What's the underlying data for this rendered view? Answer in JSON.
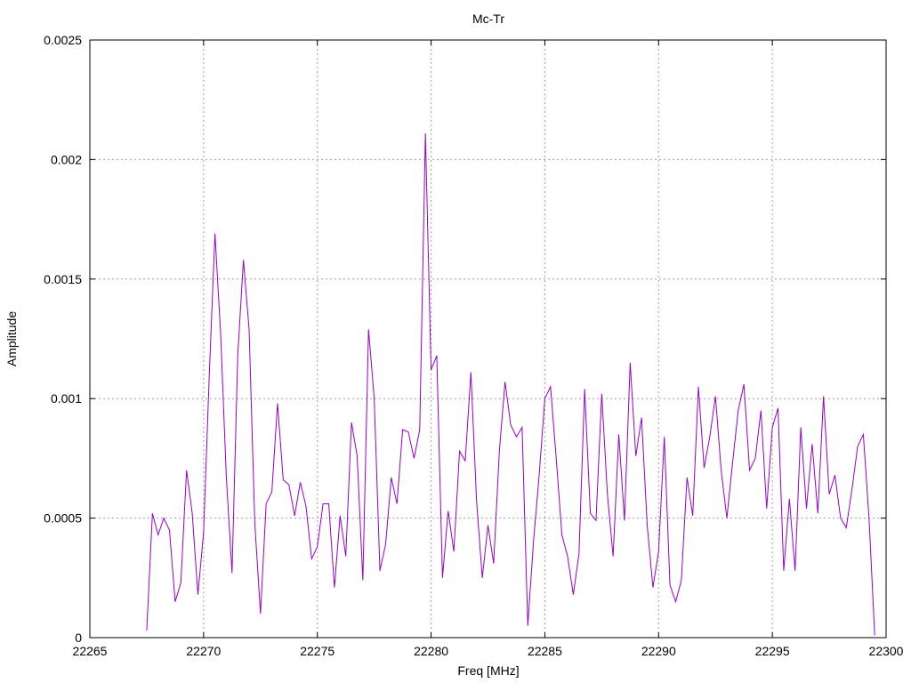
{
  "chart_data": {
    "type": "line",
    "title": "Mc-Tr",
    "xlabel": "Freq [MHz]",
    "ylabel": "Amplitude",
    "xlim": [
      22265,
      22300
    ],
    "ylim": [
      0,
      0.0025
    ],
    "x_ticks": [
      22265,
      22270,
      22275,
      22280,
      22285,
      22290,
      22295,
      22300
    ],
    "x_tick_labels": [
      "22265",
      "22270",
      "22275",
      "22280",
      "22285",
      "22290",
      "22295",
      "22300"
    ],
    "y_ticks": [
      0,
      0.0005,
      0.001,
      0.0015,
      0.002,
      0.0025
    ],
    "y_tick_labels": [
      "0",
      "0.0005",
      "0.001",
      "0.0015",
      "0.002",
      "0.0025"
    ],
    "grid": true,
    "line_color": "#9400d3",
    "series": [
      {
        "x": [
          22267.5,
          22267.75,
          22268.0,
          22268.25,
          22268.5,
          22268.75,
          22269.0,
          22269.25,
          22269.5,
          22269.75,
          22270.0,
          22270.25,
          22270.5,
          22270.75,
          22271.0,
          22271.25,
          22271.5,
          22271.75,
          22272.0,
          22272.25,
          22272.5,
          22272.75,
          22273.0,
          22273.25,
          22273.5,
          22273.75,
          22274.0,
          22274.25,
          22274.5,
          22274.75,
          22275.0,
          22275.25,
          22275.5,
          22275.75,
          22276.0,
          22276.25,
          22276.5,
          22276.75,
          22277.0,
          22277.25,
          22277.5,
          22277.75,
          22278.0,
          22278.25,
          22278.5,
          22278.75,
          22279.0,
          22279.25,
          22279.5,
          22279.75,
          22280.0,
          22280.25,
          22280.5,
          22280.75,
          22281.0,
          22281.25,
          22281.5,
          22281.75,
          22282.0,
          22282.25,
          22282.5,
          22282.75,
          22283.0,
          22283.25,
          22283.5,
          22283.75,
          22284.0,
          22284.25,
          22284.5,
          22284.75,
          22285.0,
          22285.25,
          22285.5,
          22285.75,
          22286.0,
          22286.25,
          22286.5,
          22286.75,
          22287.0,
          22287.25,
          22287.5,
          22287.75,
          22288.0,
          22288.25,
          22288.5,
          22288.75,
          22289.0,
          22289.25,
          22289.5,
          22289.75,
          22290.0,
          22290.25,
          22290.5,
          22290.75,
          22291.0,
          22291.25,
          22291.5,
          22291.75,
          22292.0,
          22292.25,
          22292.5,
          22292.75,
          22293.0,
          22293.25,
          22293.5,
          22293.75,
          22294.0,
          22294.25,
          22294.5,
          22294.75,
          22295.0,
          22295.25,
          22295.5,
          22295.75,
          22296.0,
          22296.25,
          22296.5,
          22296.75,
          22297.0,
          22297.25,
          22297.5,
          22297.75,
          22298.0,
          22298.25,
          22298.5,
          22298.75,
          22299.0,
          22299.25,
          22299.5
        ],
        "y": [
          3e-05,
          0.00052,
          0.00043,
          0.0005,
          0.00045,
          0.00015,
          0.00023,
          0.0007,
          0.00052,
          0.00018,
          0.00044,
          0.0011,
          0.00169,
          0.00127,
          0.00067,
          0.00027,
          0.00118,
          0.00158,
          0.00129,
          0.00048,
          0.0001,
          0.00056,
          0.00061,
          0.00098,
          0.00066,
          0.00064,
          0.00051,
          0.00065,
          0.00055,
          0.00033,
          0.00038,
          0.00056,
          0.00056,
          0.00021,
          0.00051,
          0.00034,
          0.0009,
          0.00076,
          0.00024,
          0.00129,
          0.001,
          0.00028,
          0.00039,
          0.00067,
          0.00056,
          0.00087,
          0.00086,
          0.00075,
          0.00087,
          0.00211,
          0.00112,
          0.00118,
          0.00025,
          0.00053,
          0.00036,
          0.00078,
          0.00074,
          0.00111,
          0.00057,
          0.00025,
          0.00047,
          0.00031,
          0.00078,
          0.00107,
          0.00089,
          0.00084,
          0.00088,
          5e-05,
          0.0004,
          0.00068,
          0.001,
          0.00105,
          0.00075,
          0.00043,
          0.00034,
          0.00018,
          0.00035,
          0.00104,
          0.00052,
          0.00049,
          0.00102,
          0.0006,
          0.00034,
          0.00085,
          0.00049,
          0.00115,
          0.00076,
          0.00092,
          0.00047,
          0.00021,
          0.00036,
          0.00084,
          0.00022,
          0.00015,
          0.00024,
          0.00067,
          0.00051,
          0.00105,
          0.00071,
          0.00084,
          0.00101,
          0.0007,
          0.0005,
          0.00073,
          0.00095,
          0.00106,
          0.0007,
          0.00075,
          0.00095,
          0.00054,
          0.00088,
          0.00096,
          0.00028,
          0.00058,
          0.00028,
          0.00088,
          0.00054,
          0.00081,
          0.00052,
          0.00101,
          0.0006,
          0.00068,
          0.0005,
          0.00046,
          0.00062,
          0.0008,
          0.00085,
          0.0005,
          1e-05
        ]
      }
    ]
  }
}
